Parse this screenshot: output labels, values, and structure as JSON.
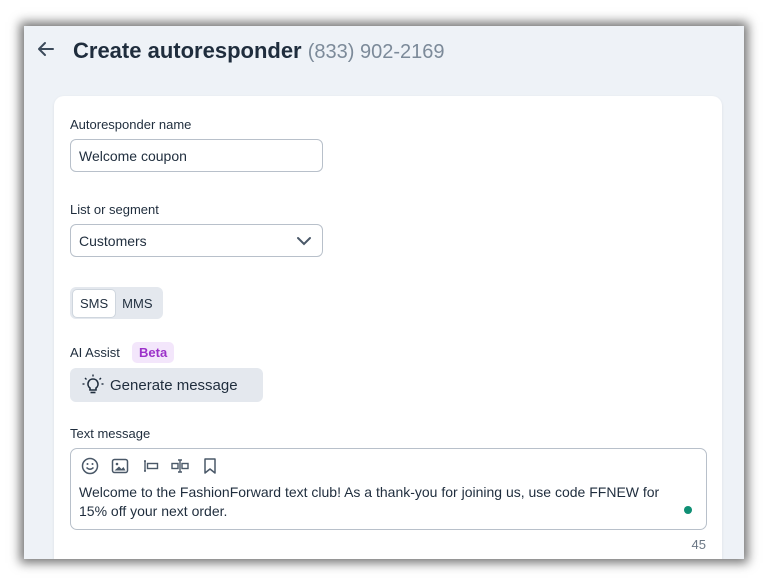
{
  "header": {
    "title": "Create autoresponder",
    "phone": "(833) 902-2169"
  },
  "form": {
    "name_label": "Autoresponder name",
    "name_value": "Welcome coupon",
    "list_label": "List or segment",
    "list_value": "Customers",
    "channel_options": [
      "SMS",
      "MMS"
    ],
    "channel_selected": "SMS",
    "ai_label": "AI Assist",
    "ai_badge": "Beta",
    "generate_label": "Generate message",
    "message_label": "Text message",
    "message_text": "Welcome to the FashionForward text club! As a thank-you for joining us, use code FFNEW for 15% off your next order.",
    "char_count": "45"
  },
  "icons": {
    "back": "arrow-left-icon",
    "chevron": "chevron-down-icon",
    "bulb": "lightbulb-icon",
    "toolbar": [
      "emoji-icon",
      "image-icon",
      "merge-field-icon",
      "shortlink-icon",
      "bookmark-icon"
    ]
  },
  "colors": {
    "accent_status": "#0f8f74",
    "beta_text": "#9b31c9",
    "beta_bg": "#f3e6fb"
  }
}
